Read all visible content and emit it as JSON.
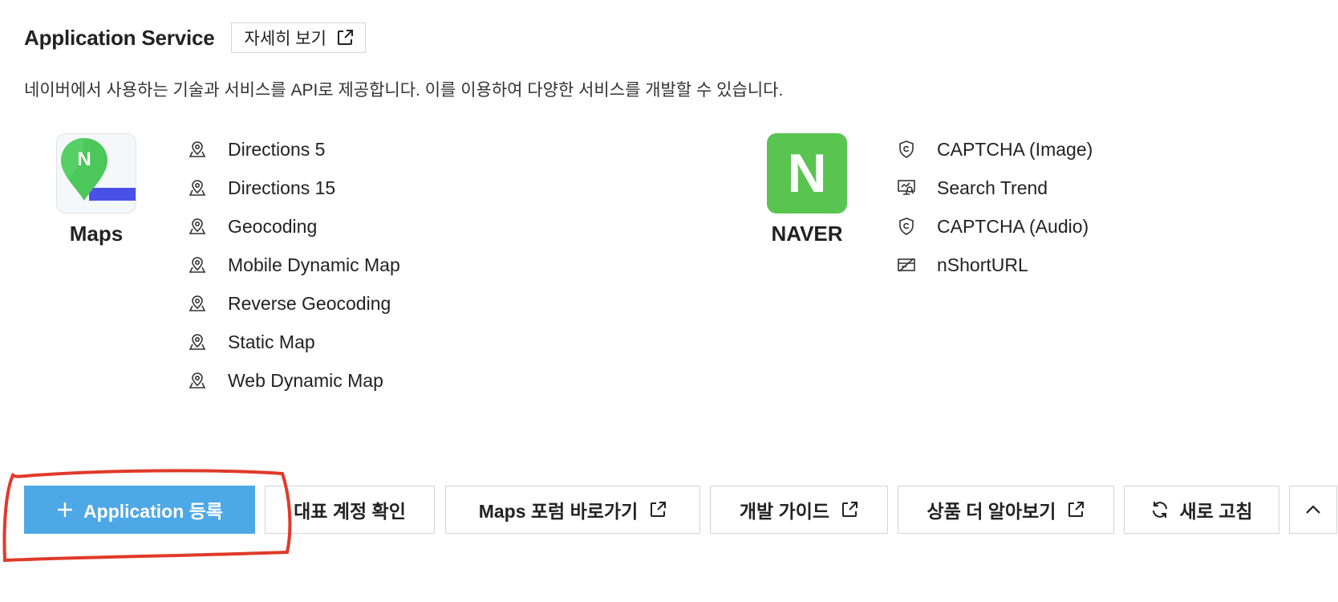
{
  "header": {
    "title": "Application Service",
    "detail_label": "자세히 보기"
  },
  "description": "네이버에서 사용하는 기술과 서비스를 API로 제공합니다. 이를 이용하여 다양한 서비스를 개발할 수 있습니다.",
  "maps": {
    "logo_label": "Maps",
    "logo_letter": "N",
    "items": [
      {
        "label": "Directions 5",
        "icon": "map-pin-icon"
      },
      {
        "label": "Directions 15",
        "icon": "map-pin-icon"
      },
      {
        "label": "Geocoding",
        "icon": "map-pin-icon"
      },
      {
        "label": "Mobile Dynamic Map",
        "icon": "map-pin-icon"
      },
      {
        "label": "Reverse Geocoding",
        "icon": "map-pin-icon"
      },
      {
        "label": "Static Map",
        "icon": "map-pin-icon"
      },
      {
        "label": "Web Dynamic Map",
        "icon": "map-pin-icon"
      }
    ]
  },
  "naver": {
    "logo_label": "NAVER",
    "logo_letter": "N",
    "items": [
      {
        "label": "CAPTCHA (Image)",
        "icon": "shield-icon"
      },
      {
        "label": "Search Trend",
        "icon": "trend-monitor-icon"
      },
      {
        "label": "CAPTCHA (Audio)",
        "icon": "shield-icon"
      },
      {
        "label": "nShortURL",
        "icon": "short-url-icon"
      }
    ]
  },
  "toolbar": {
    "register_label": "Application 등록",
    "account_label": "대표 계정 확인",
    "forum_label": "Maps 포럼 바로가기",
    "guide_label": "개발 가이드",
    "more_label": "상품 더 알아보기",
    "refresh_label": "새로 고침"
  },
  "colors": {
    "primary": "#4ea8e5",
    "naver_green": "#5ac451",
    "annotation_red": "#e03a2a"
  }
}
